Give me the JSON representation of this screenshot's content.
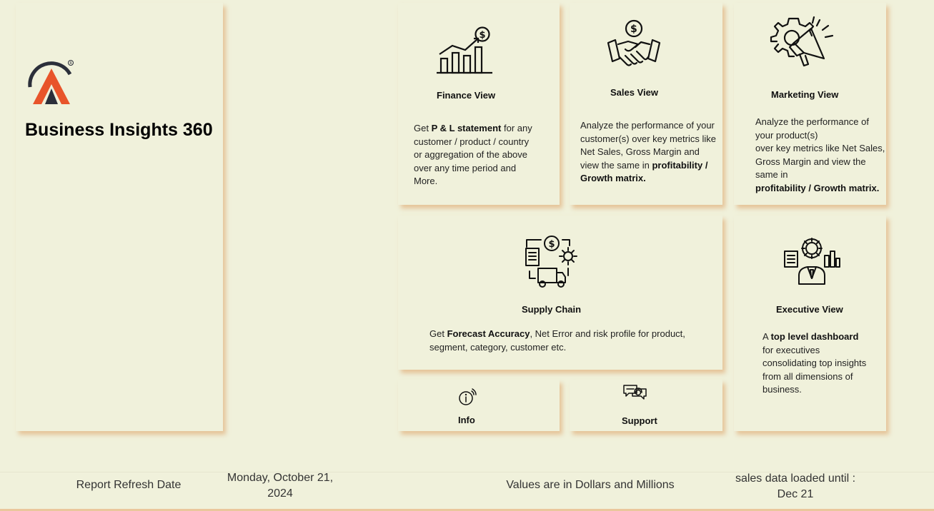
{
  "app": {
    "title": "Business Insights 360",
    "logo_icon": "atliq-logo-icon"
  },
  "cards": {
    "finance": {
      "icon": "finance-chart-dollar-icon",
      "title": "Finance View",
      "text_pre": "Get ",
      "text_bold": "P & L statement",
      "text_post": " for any customer / product / country or aggregation of the above over any time period and More."
    },
    "sales": {
      "icon": "handshake-dollar-icon",
      "title": "Sales View",
      "text_pre": "Analyze the performance of your customer(s) over key metrics like Net Sales, Gross Margin and view the same in ",
      "text_bold": "profitability / Growth matrix."
    },
    "marketing": {
      "icon": "gear-megaphone-icon",
      "title": "Marketing View",
      "text_line1": "Analyze the performance of your product(s)",
      "text_line2": "over key metrics like Net Sales, Gross Margin and view the same in ",
      "text_bold": "profitability / Growth matrix."
    },
    "supply_chain": {
      "icon": "supply-chain-icon",
      "title": "Supply Chain",
      "text_pre": "Get ",
      "text_bold": "Forecast Accuracy",
      "text_post": ", Net Error and risk profile for product, segment, category, customer etc."
    },
    "executive": {
      "icon": "executive-dashboard-icon",
      "title": "Executive View",
      "text_pre": "A ",
      "text_bold": "top level dashboard",
      "text_post": " for executives consolidating top insights from all dimensions of business."
    },
    "info": {
      "icon": "info-icon",
      "title": "Info"
    },
    "support": {
      "icon": "support-chat-icon",
      "title": "Support"
    }
  },
  "footer": {
    "refresh_label": "Report Refresh Date",
    "refresh_date_line1": "Monday, October 21,",
    "refresh_date_line2": "2024",
    "values_note": "Values are in Dollars and Millions",
    "loaded_line1": "sales data loaded until :",
    "loaded_line2": "Dec 21"
  },
  "colors": {
    "background": "#f0f1db",
    "shadow": "#e2b482",
    "logo_orange": "#e8542a",
    "logo_dark": "#2b2f3a"
  }
}
